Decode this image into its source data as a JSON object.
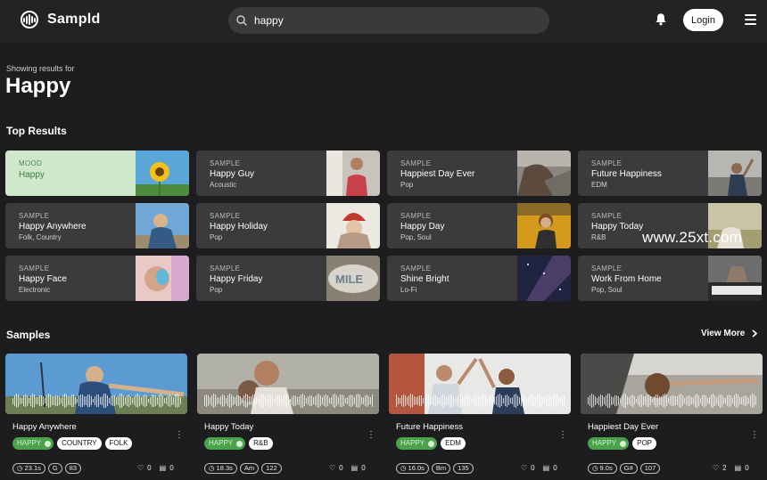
{
  "header": {
    "brand": "Sampld",
    "search_value": "happy",
    "login_label": "Login"
  },
  "heading": {
    "showing": "Showing results for",
    "query": "Happy"
  },
  "sections": {
    "top_results": "Top Results",
    "samples": "Samples",
    "view_more": "View More"
  },
  "top_results": [
    {
      "type": "MOOD",
      "title": "Happy",
      "sub": ""
    },
    {
      "type": "SAMPLE",
      "title": "Happy Guy",
      "sub": "Acoustic"
    },
    {
      "type": "SAMPLE",
      "title": "Happiest Day Ever",
      "sub": "Pop"
    },
    {
      "type": "SAMPLE",
      "title": "Future Happiness",
      "sub": "EDM"
    },
    {
      "type": "SAMPLE",
      "title": "Happy Anywhere",
      "sub": "Folk, Country"
    },
    {
      "type": "SAMPLE",
      "title": "Happy Holiday",
      "sub": "Pop"
    },
    {
      "type": "SAMPLE",
      "title": "Happy Day",
      "sub": "Pop, Soul"
    },
    {
      "type": "SAMPLE",
      "title": "Happy Today",
      "sub": "R&B"
    },
    {
      "type": "SAMPLE",
      "title": "Happy Face",
      "sub": "Electronic"
    },
    {
      "type": "SAMPLE",
      "title": "Happy Friday",
      "sub": "Pop"
    },
    {
      "type": "SAMPLE",
      "title": "Shine Bright",
      "sub": "Lo-Fi"
    },
    {
      "type": "SAMPLE",
      "title": "Work From Home",
      "sub": "Pop, Soul"
    }
  ],
  "samples": [
    {
      "title": "Happy Anywhere",
      "tags": [
        "HAPPY",
        "COUNTRY",
        "FOLK"
      ],
      "duration": "23.1s",
      "key": "G",
      "bpm": "83",
      "likes": "0",
      "comments": "0"
    },
    {
      "title": "Happy Today",
      "tags": [
        "HAPPY",
        "R&B"
      ],
      "duration": "18.3s",
      "key": "Am",
      "bpm": "122",
      "likes": "0",
      "comments": "0"
    },
    {
      "title": "Future Happiness",
      "tags": [
        "HAPPY",
        "EDM"
      ],
      "duration": "16.0s",
      "key": "Bm",
      "bpm": "135",
      "likes": "0",
      "comments": "0"
    },
    {
      "title": "Happiest Day Ever",
      "tags": [
        "HAPPY",
        "POP"
      ],
      "duration": "9.0s",
      "key": "G#",
      "bpm": "107",
      "likes": "2",
      "comments": "0"
    }
  ],
  "watermark": "www.25xt.com",
  "colors": {
    "background": "#1d1d1f",
    "header": "#232325",
    "card": "#3b3b3d",
    "mood_card": "#cfe7cb",
    "happy_tag": "#4aa24a"
  }
}
